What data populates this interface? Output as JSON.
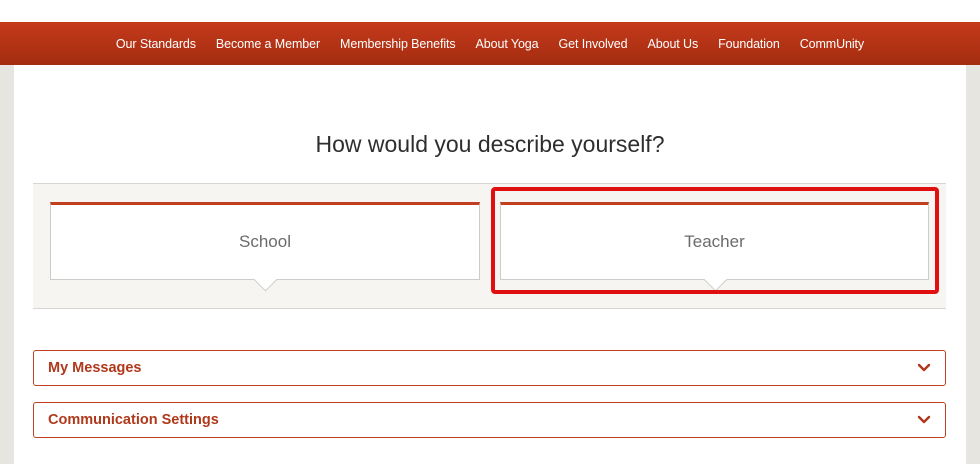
{
  "nav": {
    "items": [
      "Our Standards",
      "Become a Member",
      "Membership Benefits",
      "About Yoga",
      "Get Involved",
      "About Us",
      "Foundation",
      "CommUnity"
    ]
  },
  "heading": "How would you describe yourself?",
  "options": {
    "school": "School",
    "teacher": "Teacher"
  },
  "accordions": {
    "messages": "My Messages",
    "communication": "Communication Settings"
  },
  "colors": {
    "brand": "#b53417",
    "highlight": "#e11010"
  }
}
